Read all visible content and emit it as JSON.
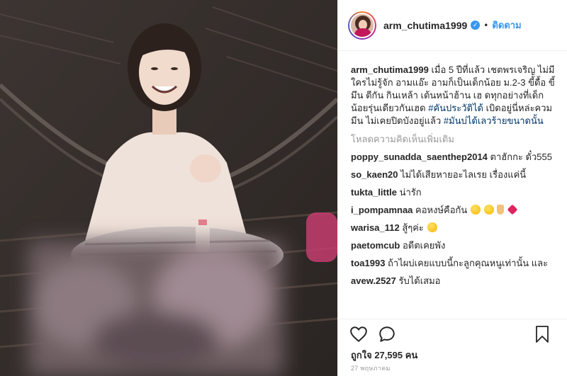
{
  "post": {
    "username": "arm_chutima1999",
    "verified_mark": "✓",
    "separator": "•",
    "follow_label": "ติดตาม"
  },
  "caption": {
    "username": "arm_chutima1999",
    "text1": "เมื่อ 5 ปีที่แล้ว เชตพรเจริญ ไม่มีใครไม่รู้จัก อามแอ๊ะ อามก็เป็นเด็กน้อย ม.2-3 ขี้ดื้อ ขี้มึน ตีกัน กินเหล้า เต้นหน้าฮ้าน เฮ ดทุกอย่างที่เด็กน้อยรุ่นเดียวกันเฮด",
    "tag1": "#คันประวัติได้",
    "text2": "เบิดอยู่นี่หล่ะควมมีน ไม่เคยปิดบังอยู่แล้ว",
    "tag2": "#มันบ่ได้เลวร้ายขนาดนั้น"
  },
  "load_more_label": "โหลดความคิดเห็นเพิ่มเติม",
  "comments": [
    {
      "user": "poppy_sunadda_saenthep2014",
      "text": "ตาฮักกะ ดั๋ว555"
    },
    {
      "user": "so_kaen20",
      "text": "ไม่ได้เสียหายอะไลเรย เรื่องแค่นี้"
    },
    {
      "user": "tukta_little",
      "text": "น่ารัก"
    },
    {
      "user": "i_pompamnaa",
      "text": "คอหงษ์คือกัน"
    },
    {
      "user": "warisa_112",
      "text": "สู้ๆค่ะ"
    },
    {
      "user": "paetomcub",
      "text": "อดีตเคยพัง"
    },
    {
      "user": "toa1993",
      "text": "ถ้าไผบ่เคยแบบนี้กะลูกคุณหนูเท่านั้น และ"
    },
    {
      "user": "avew.2527",
      "text": "รับได้เสมอ"
    }
  ],
  "likes": {
    "label": "ถูกใจ 27,595 คน"
  },
  "timestamp": "27 พฤษภาคม",
  "icons": {
    "like": "heart-icon",
    "comment": "comment-bubble-icon",
    "save": "bookmark-icon"
  },
  "colors": {
    "link_blue": "#3897f0",
    "hashtag": "#003569",
    "muted": "#999999"
  }
}
